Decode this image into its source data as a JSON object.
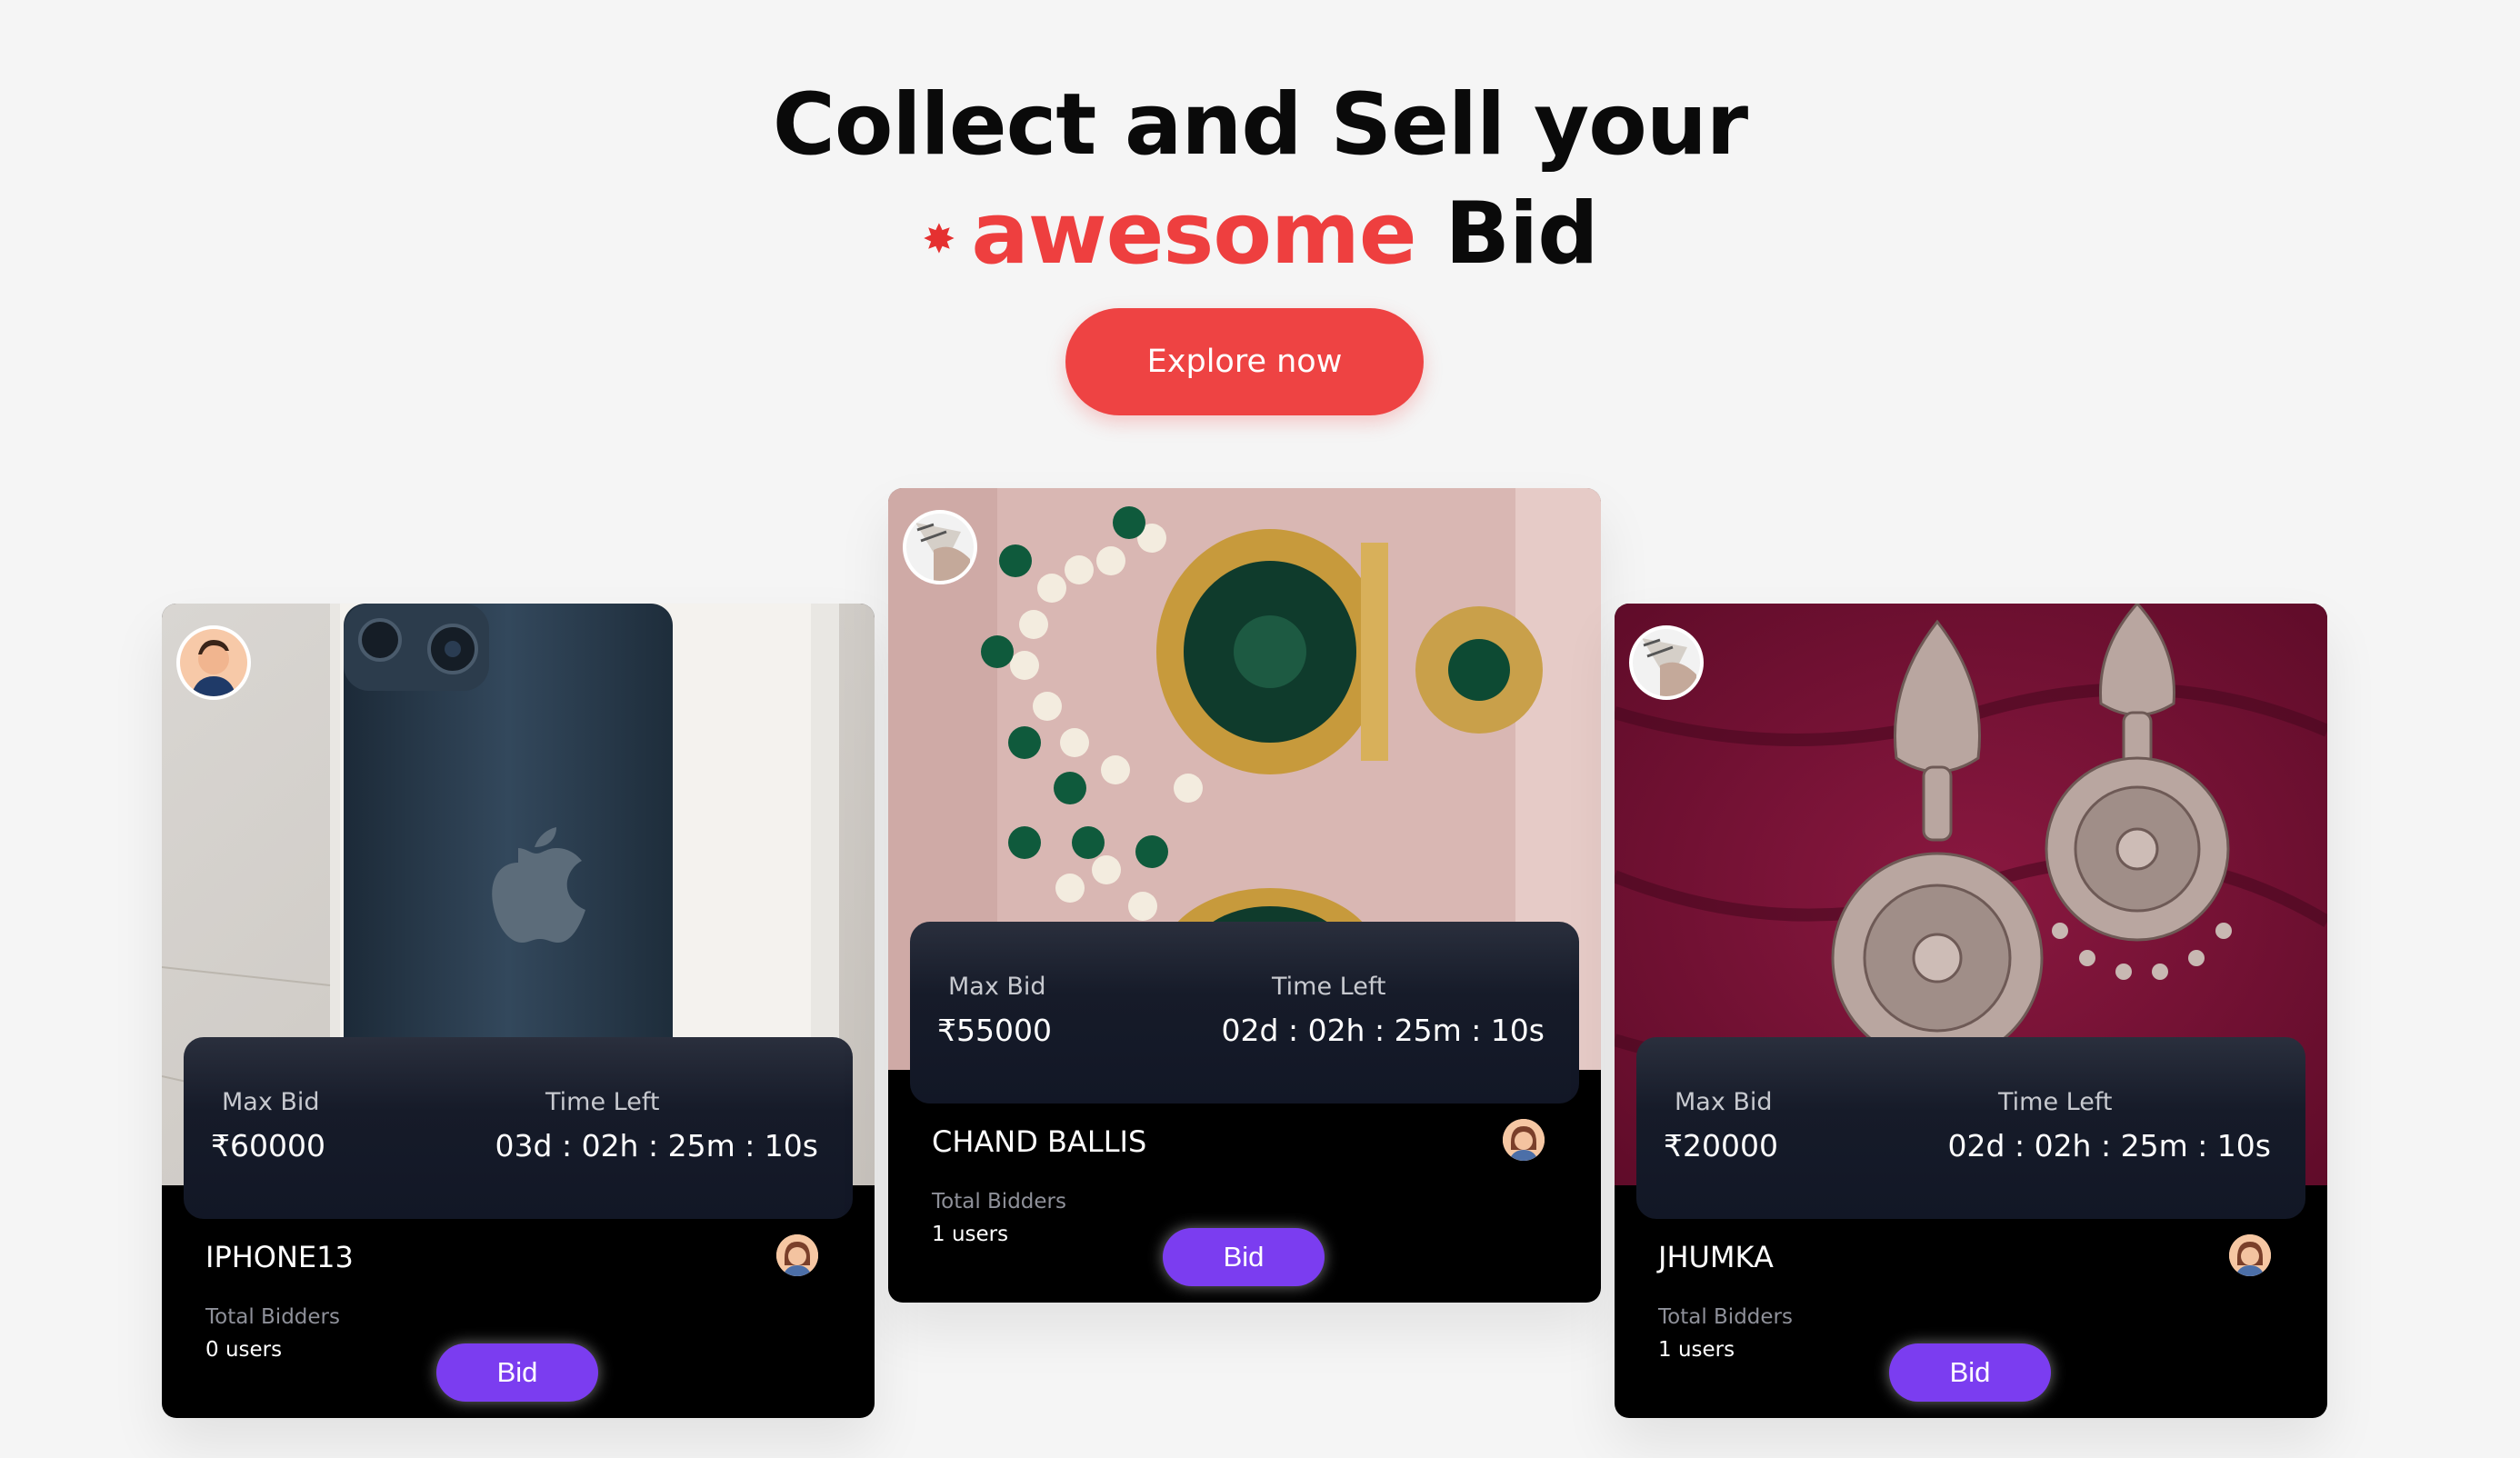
{
  "hero": {
    "line1": "Collect and Sell your",
    "accent_word": "awesome",
    "tail_word": "Bid",
    "star_glyph": "✸",
    "explore_label": "Explore now"
  },
  "labels": {
    "max_bid": "Max Bid",
    "time_left": "Time Left",
    "total_bidders": "Total Bidders",
    "bid_button": "Bid"
  },
  "cards": [
    {
      "title": "IPHONE13",
      "max_bid": "₹60000",
      "time_left": "03d : 02h : 25m : 10s",
      "bidders": "0 users"
    },
    {
      "title": "CHAND BALLIS",
      "max_bid": "₹55000",
      "time_left": "02d : 02h : 25m : 10s",
      "bidders": "1 users"
    },
    {
      "title": "JHUMKA",
      "max_bid": "₹20000",
      "time_left": "02d : 02h : 25m : 10s",
      "bidders": "1 users"
    }
  ],
  "colors": {
    "accent": "#ee3f3f",
    "explore_button": "#ee4343",
    "bid_button": "#7b3df0",
    "card_bg": "#000000",
    "info_panel": "#161b29"
  }
}
